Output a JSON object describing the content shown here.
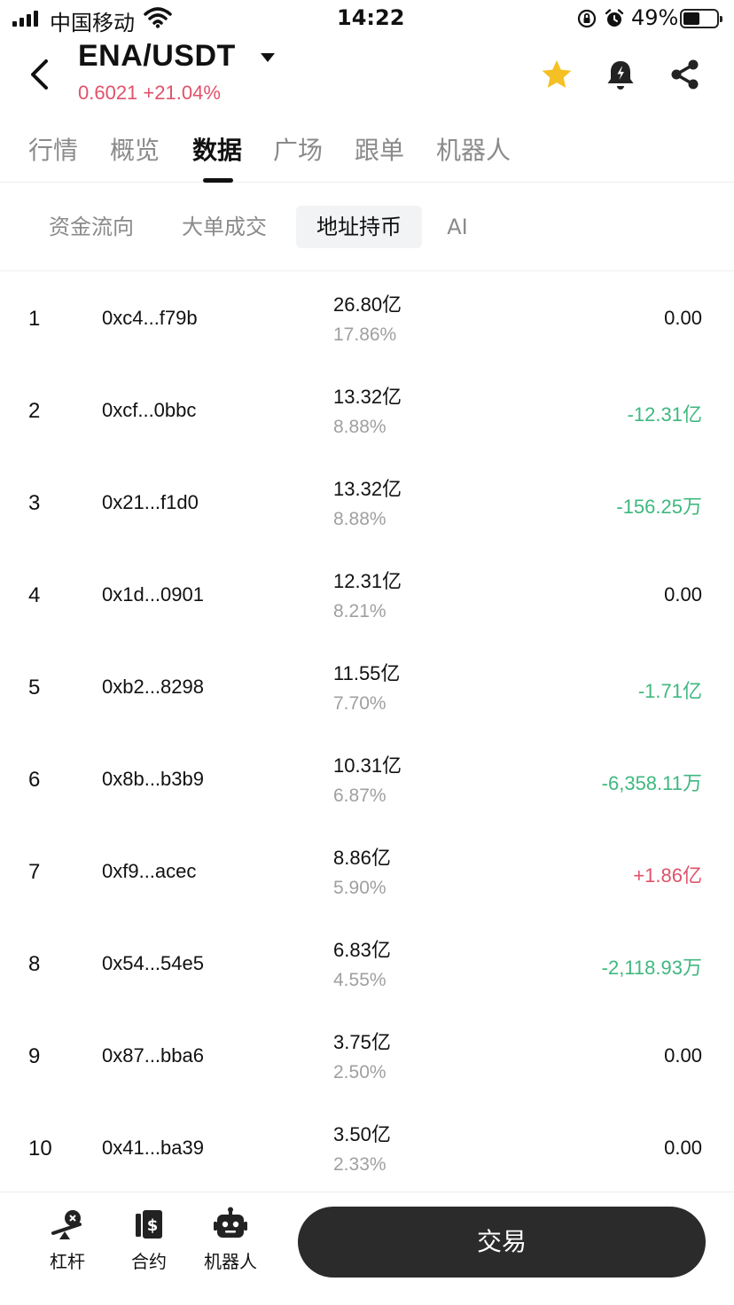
{
  "status_bar": {
    "carrier": "中国移动",
    "time": "14:22",
    "battery": "49%",
    "battery_level": 0.49,
    "icons": [
      "signal-icon",
      "wifi-icon",
      "rotation-lock-icon",
      "alarm-icon",
      "battery-icon"
    ]
  },
  "header": {
    "pair": "ENA/USDT",
    "price": "0.6021",
    "change": "+21.04%",
    "colors": {
      "up": "#e0526b",
      "down": "#3fb87f",
      "star": "#f5c024"
    }
  },
  "tabs": [
    "行情",
    "概览",
    "数据",
    "广场",
    "跟单",
    "机器人"
  ],
  "active_tab": "数据",
  "subtabs": [
    "资金流向",
    "大单成交",
    "地址持币",
    "AI"
  ],
  "active_subtab": "地址持币",
  "holders": [
    {
      "rank": "1",
      "address": "0xc4...f79b",
      "amount": "26.80亿",
      "percent": "17.86%",
      "change": "0.00",
      "direction": "neutral"
    },
    {
      "rank": "2",
      "address": "0xcf...0bbc",
      "amount": "13.32亿",
      "percent": "8.88%",
      "change": "-12.31亿",
      "direction": "down"
    },
    {
      "rank": "3",
      "address": "0x21...f1d0",
      "amount": "13.32亿",
      "percent": "8.88%",
      "change": "-156.25万",
      "direction": "down"
    },
    {
      "rank": "4",
      "address": "0x1d...0901",
      "amount": "12.31亿",
      "percent": "8.21%",
      "change": "0.00",
      "direction": "neutral"
    },
    {
      "rank": "5",
      "address": "0xb2...8298",
      "amount": "11.55亿",
      "percent": "7.70%",
      "change": "-1.71亿",
      "direction": "down"
    },
    {
      "rank": "6",
      "address": "0x8b...b3b9",
      "amount": "10.31亿",
      "percent": "6.87%",
      "change": "-6,358.11万",
      "direction": "down"
    },
    {
      "rank": "7",
      "address": "0xf9...acec",
      "amount": "8.86亿",
      "percent": "5.90%",
      "change": "+1.86亿",
      "direction": "up"
    },
    {
      "rank": "8",
      "address": "0x54...54e5",
      "amount": "6.83亿",
      "percent": "4.55%",
      "change": "-2,118.93万",
      "direction": "down"
    },
    {
      "rank": "9",
      "address": "0x87...bba6",
      "amount": "3.75亿",
      "percent": "2.50%",
      "change": "0.00",
      "direction": "neutral"
    },
    {
      "rank": "10",
      "address": "0x41...ba39",
      "amount": "3.50亿",
      "percent": "2.33%",
      "change": "0.00",
      "direction": "neutral"
    }
  ],
  "bottom_nav": {
    "items": [
      {
        "label": "杠杆",
        "icon": "leverage-icon"
      },
      {
        "label": "合约",
        "icon": "contract-icon"
      },
      {
        "label": "机器人",
        "icon": "robot-icon"
      }
    ],
    "trade_button": "交易"
  }
}
